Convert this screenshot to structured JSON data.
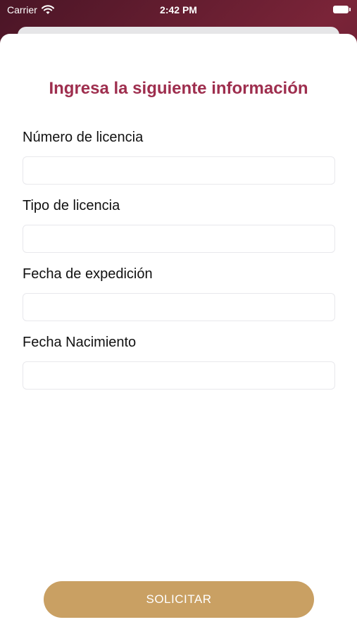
{
  "status_bar": {
    "carrier": "Carrier",
    "time": "2:42 PM",
    "icons": [
      "wifi-icon",
      "battery-icon"
    ]
  },
  "form": {
    "title": "Ingresa la siguiente información",
    "title_color": "#9e2e4e",
    "fields": [
      {
        "label": "Número de licencia",
        "value": "",
        "placeholder": ""
      },
      {
        "label": "Tipo de licencia",
        "value": "",
        "placeholder": ""
      },
      {
        "label": "Fecha de expedición",
        "value": "",
        "placeholder": ""
      },
      {
        "label": "Fecha Nacimiento",
        "value": "",
        "placeholder": ""
      }
    ],
    "submit_label": "SOLICITAR",
    "submit_color": "#c9a063"
  }
}
